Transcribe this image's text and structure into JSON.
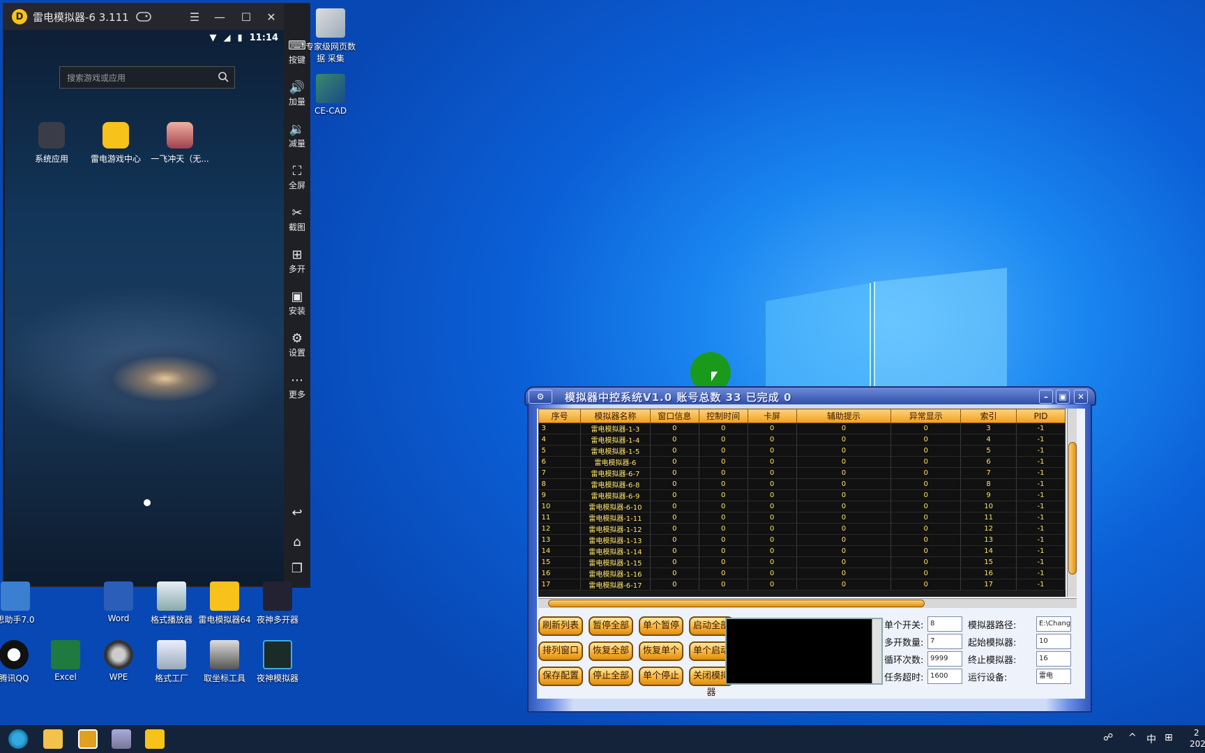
{
  "emulator": {
    "title": "雷电模拟器-6 3.111",
    "time": "11:14",
    "search_placeholder": "搜索游戏或应用",
    "apps": [
      {
        "label": "系统应用"
      },
      {
        "label": "雷电游戏中心"
      },
      {
        "label": "一飞冲天（无..."
      }
    ],
    "sidebar": [
      {
        "label": "按键"
      },
      {
        "label": "加量"
      },
      {
        "label": "减量"
      },
      {
        "label": "全屏"
      },
      {
        "label": "截图"
      },
      {
        "label": "多开"
      },
      {
        "label": "安装"
      },
      {
        "label": "设置"
      },
      {
        "label": "更多"
      }
    ]
  },
  "desktop_icons": [
    {
      "label": "专家级网页数据 采集"
    },
    {
      "label": "CE-CAD"
    },
    {
      "label": "思助手7.0"
    },
    {
      "label": "Word"
    },
    {
      "label": "格式播放器"
    },
    {
      "label": "雷电模拟器64"
    },
    {
      "label": "夜神多开器"
    },
    {
      "label": "腾讯QQ"
    },
    {
      "label": "Excel"
    },
    {
      "label": "WPE"
    },
    {
      "label": "格式工厂"
    },
    {
      "label": "取坐标工具"
    },
    {
      "label": "夜神模拟器"
    }
  ],
  "control": {
    "title": "模拟器中控系统V1.0 账号总数 33 已完成 0",
    "columns": [
      "序号",
      "模拟器名称",
      "窗口信息",
      "控制时间",
      "卡屏",
      "辅助提示",
      "异常显示",
      "索引",
      "PID"
    ],
    "rows": [
      [
        "3",
        "雷电模拟器-1-3",
        "0",
        "0",
        "0",
        "0",
        "0",
        "3",
        "-1"
      ],
      [
        "4",
        "雷电模拟器-1-4",
        "0",
        "0",
        "0",
        "0",
        "0",
        "4",
        "-1"
      ],
      [
        "5",
        "雷电模拟器-1-5",
        "0",
        "0",
        "0",
        "0",
        "0",
        "5",
        "-1"
      ],
      [
        "6",
        "雷电模拟器-6",
        "0",
        "0",
        "0",
        "0",
        "0",
        "6",
        "-1"
      ],
      [
        "7",
        "雷电模拟器-6-7",
        "0",
        "0",
        "0",
        "0",
        "0",
        "7",
        "-1"
      ],
      [
        "8",
        "雷电模拟器-6-8",
        "0",
        "0",
        "0",
        "0",
        "0",
        "8",
        "-1"
      ],
      [
        "9",
        "雷电模拟器-6-9",
        "0",
        "0",
        "0",
        "0",
        "0",
        "9",
        "-1"
      ],
      [
        "10",
        "雷电模拟器-6-10",
        "0",
        "0",
        "0",
        "0",
        "0",
        "10",
        "-1"
      ],
      [
        "11",
        "雷电模拟器-1-11",
        "0",
        "0",
        "0",
        "0",
        "0",
        "11",
        "-1"
      ],
      [
        "12",
        "雷电模拟器-1-12",
        "0",
        "0",
        "0",
        "0",
        "0",
        "12",
        "-1"
      ],
      [
        "13",
        "雷电模拟器-1-13",
        "0",
        "0",
        "0",
        "0",
        "0",
        "13",
        "-1"
      ],
      [
        "14",
        "雷电模拟器-1-14",
        "0",
        "0",
        "0",
        "0",
        "0",
        "14",
        "-1"
      ],
      [
        "15",
        "雷电模拟器-1-15",
        "0",
        "0",
        "0",
        "0",
        "0",
        "15",
        "-1"
      ],
      [
        "16",
        "雷电模拟器-1-16",
        "0",
        "0",
        "0",
        "0",
        "0",
        "16",
        "-1"
      ],
      [
        "17",
        "雷电模拟器-6-17",
        "0",
        "0",
        "0",
        "0",
        "0",
        "17",
        "-1"
      ]
    ],
    "buttons": [
      [
        "刷新列表",
        "暂停全部",
        "单个暂停",
        "启动全部"
      ],
      [
        "排列窗口",
        "恢复全部",
        "恢复单个",
        "单个启动"
      ],
      [
        "保存配置",
        "停止全部",
        "单个停止",
        "关闭模拟器"
      ]
    ],
    "fields_left": [
      {
        "label": "单个开关:",
        "value": "8"
      },
      {
        "label": "多开数量:",
        "value": "7"
      },
      {
        "label": "循环次数:",
        "value": "9999"
      },
      {
        "label": "任务超时:",
        "value": "1600"
      }
    ],
    "fields_right": [
      {
        "label": "模拟器路径:",
        "value": "E:\\Chang"
      },
      {
        "label": "起始模拟器:",
        "value": "10"
      },
      {
        "label": "终止模拟器:",
        "value": "16"
      },
      {
        "label": "运行设备:",
        "value": "雷电"
      }
    ]
  },
  "taskbar": {
    "ime": "中",
    "clock": "2",
    "date": "202"
  }
}
